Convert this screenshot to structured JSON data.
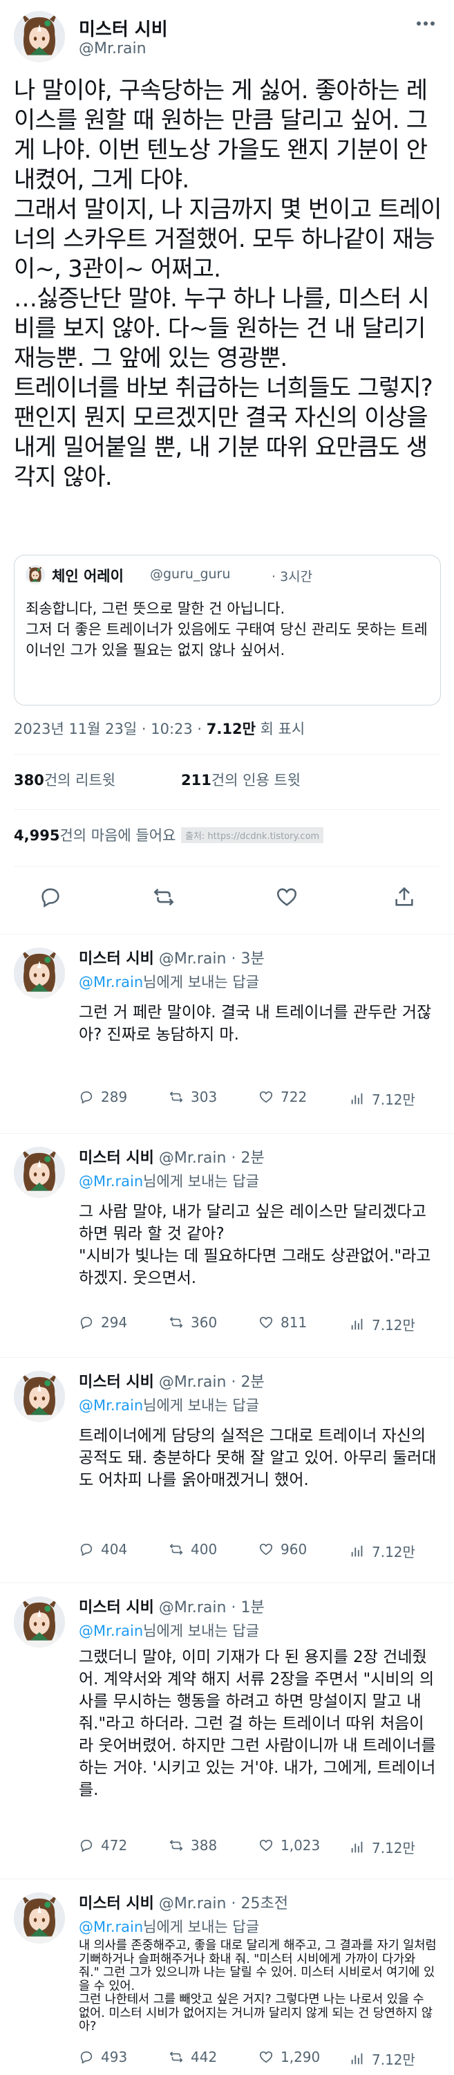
{
  "main_tweet": {
    "display_name": "미스터 시비",
    "handle": "@Mr.rain",
    "more_icon": "more-dots-icon",
    "text": "나 말이야, 구속당하는 게 싫어. 좋아하는 레이스를 원할 때 원하는 만큼 달리고 싶어. 그게 나야. 이번 텐노상 가을도 왠지 기분이 안 내켰어, 그게 다야.\n그래서 말이지, 나 지금까지 몇 번이고 트레이너의 스카우트 거절했어. 모두 하나같이 재능이~, 3관이~ 어쩌고.\n…싫증난단 말야. 누구 하나 나를, 미스터 시비를 보지 않아. 다~들 원하는 건 내 달리기 재능뿐. 그 앞에 있는 영광뿐.\n트레이너를 바보 취급하는 너희들도 그렇지? 팬인지 뭔지 모르겠지만 결국 자신의 이상을 내게 밀어붙일 뿐, 내 기분 따위 요만큼도 생각지 않아.",
    "quote": {
      "display_name": "체인 어레이",
      "handle": "@guru_guru",
      "time": "· 3시간",
      "text": "죄송합니다, 그런 뜻으로 말한 건 아닙니다.\n그저 더 좋은 트레이너가 있음에도 구태여 당신 관리도 못하는 트레이너인 그가 있을 필요는 없지 않나 싶어서."
    },
    "meta": {
      "datetime": "2023년 11월 23일 · 10:23 · ",
      "views": "7.12만",
      "views_suffix": " 회 표시"
    },
    "retweets": {
      "count": "380",
      "label": "건의 리트윗"
    },
    "quotes": {
      "count": "211",
      "label": "건의 인용 트윗"
    },
    "likes": {
      "count": "4,995",
      "label": "건의 마음에 들어요"
    },
    "watermark": "출처: https://dcdnk.tistory.com",
    "actions": [
      "reply-icon",
      "retweet-icon",
      "like-icon",
      "share-icon"
    ]
  },
  "replies": [
    {
      "display_name": "미스터 시비",
      "handle": "@Mr.rain",
      "time": "· 3분",
      "replying_handle": "@Mr.rain",
      "replying_suffix": "님에게 보내는 답글",
      "text": "그런 거 페란 말이야. 결국 내 트레이너를 관두란 거잖아? 진짜로 농담하지 마.",
      "replies": "289",
      "retweets": "303",
      "likes": "722",
      "views": "7.12만"
    },
    {
      "display_name": "미스터 시비",
      "handle": "@Mr.rain",
      "time": "· 2분",
      "replying_handle": "@Mr.rain",
      "replying_suffix": "님에게 보내는 답글",
      "text": "그 사람 말야, 내가 달리고 싶은 레이스만 달리겠다고 하면 뭐라 할 것 같아?\n\"시비가 빛나는 데 필요하다면 그래도 상관없어.\"라고 하겠지. 웃으면서.",
      "replies": "294",
      "retweets": "360",
      "likes": "811",
      "views": "7.12만"
    },
    {
      "display_name": "미스터 시비",
      "handle": "@Mr.rain",
      "time": "· 2분",
      "replying_handle": "@Mr.rain",
      "replying_suffix": "님에게 보내는 답글",
      "text": "트레이너에게 담당의 실적은 그대로 트레이너 자신의 공적도 돼. 충분하다 못해 잘 알고 있어. 아무리 둘러대도 어차피 나를 옭아매겠거니 했어.",
      "replies": "404",
      "retweets": "400",
      "likes": "960",
      "views": "7.12만"
    },
    {
      "display_name": "미스터 시비",
      "handle": "@Mr.rain",
      "time": "· 1분",
      "replying_handle": "@Mr.rain",
      "replying_suffix": "님에게 보내는 답글",
      "text": "그랬더니 말야, 이미 기재가 다 된 용지를 2장 건네줬어. 계약서와 계약 해지 서류 2장을 주면서 \"시비의 의사를 무시하는 행동을 하려고 하면 망설이지 말고 내줘.\"라고 하더라. 그런 걸 하는 트레이너 따위 처음이라 웃어버렸어. 하지만 그런 사람이니까 내 트레이너를 하는 거야. '시키고 있는 거'야. 내가, 그에게, 트레이너를.",
      "replies": "472",
      "retweets": "388",
      "likes": "1,023",
      "views": "7.12만"
    },
    {
      "display_name": "미스터 시비",
      "handle": "@Mr.rain",
      "time": "· 25초전",
      "replying_handle": "@Mr.rain",
      "replying_suffix": "님에게 보내는 답글",
      "text": "내 의사를 존중해주고, 좋을 대로 달리게 해주고, 그 결과를 자기 일처럼 기뻐하거나 슬퍼해주거나 화내 줘. \"미스터 시비에게 가까이 다가와 줘.\" 그런 그가 있으니까 나는 달릴 수 있어. 미스터 시비로서 여기에 있을 수 있어.\n그런 나한테서 그를 빼앗고 싶은 거지? 그렇다면 나는 나로서 있을 수 없어. 미스터 시비가 없어지는 거니까 달리지 않게 되는 건 당연하지 않아?",
      "replies": "493",
      "retweets": "442",
      "likes": "1,290",
      "views": "7.12만"
    }
  ],
  "colors": {
    "accent": "#1d9bf0",
    "text": "#0f1419",
    "muted": "#536471",
    "border": "#eff3f4"
  }
}
